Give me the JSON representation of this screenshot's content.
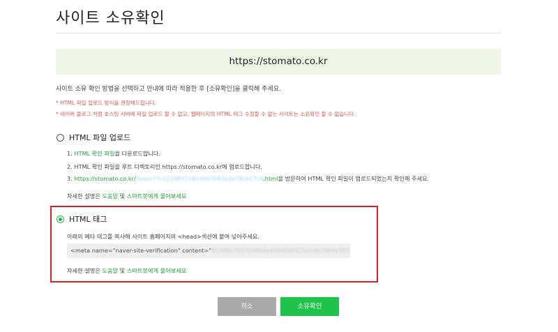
{
  "page": {
    "title": "사이트 소유확인"
  },
  "site": {
    "url": "https://stomato.co.kr"
  },
  "intro": "사이트 소유 확인 방법을 선택하고 안내에 따라 적용한 후 [소유확인]을 클릭해 주세요.",
  "warnings": [
    "* HTML 파일 업로드 방식을 권장해드립니다.",
    "* 네이버 블로그 처럼 호스팅 서버에 파일 업로드 할 수 없고, 웹페이지의 HTML 태그 수정할 수 없는 사이트는 소유확인 할 수 없습니다."
  ],
  "option_file": {
    "label": "HTML 파일 업로드",
    "selected": false,
    "step1_num": "1.",
    "step1_link": "HTML 확인 파일",
    "step1_text": "을 다운로드합니다.",
    "step2": "2. HTML 확인 파일을 루트 디렉토리인 https://stomato.co.kr에 업로드합니다.",
    "step3_num": "3.",
    "step3_link_prefix": "https://stomato.co.kr/",
    "step3_link_blur": "naver77c1220837181d407b93a3a79cb17c9",
    "step3_link_suffix": ".html",
    "step3_text": "을 방문하여 HTML 확인 파일이 업로드되었는지 확인해 주세요.",
    "help_prefix": "자세한 설명은",
    "help_link1": "도움말",
    "help_mid": "및",
    "help_link2": "스마트봇에게 물어보세요"
  },
  "option_tag": {
    "label": "HTML 태그",
    "selected": true,
    "instruction": "아래의 메타 태그를 복사해 사이트 홈페이지의 <head>섹션에 붙여 넣어주세요.",
    "meta_prefix": "<meta name=\"naver-site-verification\" content=\"",
    "meta_blur": "9139657627008b9e45980d0421d2d67984e3551",
    "meta_suffix": "\" />",
    "help_prefix": "자세한 설명은",
    "help_link1": "도움말",
    "help_mid": "및",
    "help_link2": "스마트봇에게 물어보세요"
  },
  "buttons": {
    "cancel": "취소",
    "confirm": "소유확인"
  },
  "colors": {
    "accent_green": "#1fc24a",
    "link_green": "#1ea43e",
    "warning_red": "#e5574b",
    "highlight_red": "#dd1f26",
    "site_box_bg": "#eef6e8"
  }
}
